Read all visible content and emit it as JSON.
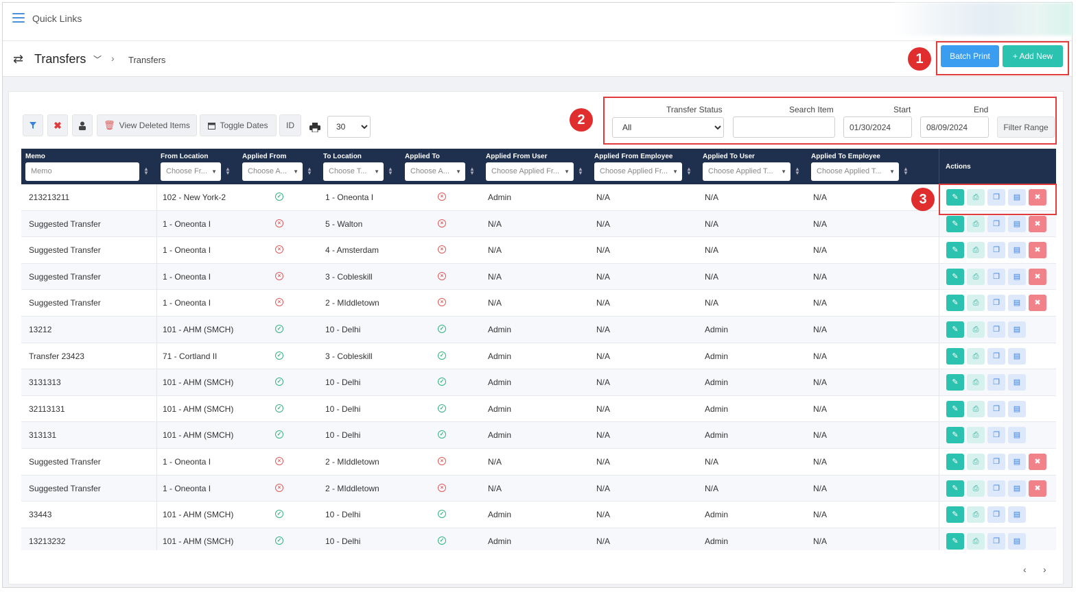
{
  "quick_links": {
    "label": "Quick Links"
  },
  "header": {
    "title": "Transfers",
    "breadcrumb": "Transfers"
  },
  "actions": {
    "batch_print": "Batch Print",
    "add_new": "+ Add New"
  },
  "markers": [
    "1",
    "2",
    "3"
  ],
  "toolbar": {
    "view_deleted": "View Deleted Items",
    "toggle_dates": "Toggle Dates",
    "id": "ID",
    "page_size": "30"
  },
  "filters": {
    "transfer_status_label": "Transfer Status",
    "transfer_status_value": "All",
    "search_item_label": "Search Item",
    "search_item_value": "",
    "start_label": "Start",
    "start_value": "01/30/2024",
    "end_label": "End",
    "end_value": "08/09/2024",
    "filter_range": "Filter Range"
  },
  "columns": {
    "memo": {
      "label": "Memo",
      "placeholder": "Memo"
    },
    "from_location": {
      "label": "From Location",
      "placeholder": "Choose Fr..."
    },
    "applied_from": {
      "label": "Applied From",
      "placeholder": "Choose A..."
    },
    "to_location": {
      "label": "To Location",
      "placeholder": "Choose T..."
    },
    "applied_to": {
      "label": "Applied To",
      "placeholder": "Choose A..."
    },
    "applied_from_user": {
      "label": "Applied From User",
      "placeholder": "Choose Applied Fr..."
    },
    "applied_from_employee": {
      "label": "Applied From Employee",
      "placeholder": "Choose Applied Fr..."
    },
    "applied_to_user": {
      "label": "Applied To User",
      "placeholder": "Choose Applied T..."
    },
    "applied_to_employee": {
      "label": "Applied To Employee",
      "placeholder": "Choose Applied T..."
    },
    "actions": {
      "label": "Actions"
    }
  },
  "rows": [
    {
      "memo": "213213211",
      "from": "102 - New York-2",
      "applied_from": "ok",
      "to": "1 - Oneonta I",
      "applied_to": "bad",
      "from_user": "Admin",
      "from_emp": "N/A",
      "to_user": "N/A",
      "to_emp": "N/A",
      "deletable": true
    },
    {
      "memo": "Suggested Transfer",
      "from": "1 - Oneonta I",
      "applied_from": "bad",
      "to": "5 - Walton",
      "applied_to": "bad",
      "from_user": "N/A",
      "from_emp": "N/A",
      "to_user": "N/A",
      "to_emp": "N/A",
      "deletable": true
    },
    {
      "memo": "Suggested Transfer",
      "from": "1 - Oneonta I",
      "applied_from": "bad",
      "to": "4 - Amsterdam",
      "applied_to": "bad",
      "from_user": "N/A",
      "from_emp": "N/A",
      "to_user": "N/A",
      "to_emp": "N/A",
      "deletable": true
    },
    {
      "memo": "Suggested Transfer",
      "from": "1 - Oneonta I",
      "applied_from": "bad",
      "to": "3 - Cobleskill",
      "applied_to": "bad",
      "from_user": "N/A",
      "from_emp": "N/A",
      "to_user": "N/A",
      "to_emp": "N/A",
      "deletable": true
    },
    {
      "memo": "Suggested Transfer",
      "from": "1 - Oneonta I",
      "applied_from": "bad",
      "to": "2 - MIddletown",
      "applied_to": "bad",
      "from_user": "N/A",
      "from_emp": "N/A",
      "to_user": "N/A",
      "to_emp": "N/A",
      "deletable": true
    },
    {
      "memo": "13212",
      "from": "101 - AHM (SMCH)",
      "applied_from": "ok",
      "to": "10 - Delhi",
      "applied_to": "ok",
      "from_user": "Admin",
      "from_emp": "N/A",
      "to_user": "Admin",
      "to_emp": "N/A",
      "deletable": false
    },
    {
      "memo": "Transfer 23423",
      "from": "71 - Cortland II",
      "applied_from": "ok",
      "to": "3 - Cobleskill",
      "applied_to": "ok",
      "from_user": "Admin",
      "from_emp": "N/A",
      "to_user": "Admin",
      "to_emp": "N/A",
      "deletable": false
    },
    {
      "memo": "3131313",
      "from": "101 - AHM (SMCH)",
      "applied_from": "ok",
      "to": "10 - Delhi",
      "applied_to": "ok",
      "from_user": "Admin",
      "from_emp": "N/A",
      "to_user": "Admin",
      "to_emp": "N/A",
      "deletable": false
    },
    {
      "memo": "32113131",
      "from": "101 - AHM (SMCH)",
      "applied_from": "ok",
      "to": "10 - Delhi",
      "applied_to": "ok",
      "from_user": "Admin",
      "from_emp": "N/A",
      "to_user": "Admin",
      "to_emp": "N/A",
      "deletable": false
    },
    {
      "memo": "313131",
      "from": "101 - AHM (SMCH)",
      "applied_from": "ok",
      "to": "10 - Delhi",
      "applied_to": "ok",
      "from_user": "Admin",
      "from_emp": "N/A",
      "to_user": "Admin",
      "to_emp": "N/A",
      "deletable": false
    },
    {
      "memo": "Suggested Transfer",
      "from": "1 - Oneonta I",
      "applied_from": "bad",
      "to": "2 - MIddletown",
      "applied_to": "bad",
      "from_user": "N/A",
      "from_emp": "N/A",
      "to_user": "N/A",
      "to_emp": "N/A",
      "deletable": true
    },
    {
      "memo": "Suggested Transfer",
      "from": "1 - Oneonta I",
      "applied_from": "bad",
      "to": "2 - MIddletown",
      "applied_to": "bad",
      "from_user": "N/A",
      "from_emp": "N/A",
      "to_user": "N/A",
      "to_emp": "N/A",
      "deletable": true
    },
    {
      "memo": "33443",
      "from": "101 - AHM (SMCH)",
      "applied_from": "ok",
      "to": "10 - Delhi",
      "applied_to": "ok",
      "from_user": "Admin",
      "from_emp": "N/A",
      "to_user": "Admin",
      "to_emp": "N/A",
      "deletable": false
    },
    {
      "memo": "13213232",
      "from": "101 - AHM (SMCH)",
      "applied_from": "ok",
      "to": "10 - Delhi",
      "applied_to": "ok",
      "from_user": "Admin",
      "from_emp": "N/A",
      "to_user": "Admin",
      "to_emp": "N/A",
      "deletable": false
    }
  ],
  "pager": {
    "prev": "‹",
    "next": "›"
  },
  "icons": {
    "menu": "hamburger-icon",
    "transfer": "swap-arrows-icon",
    "filter": "funnel-icon",
    "clear": "x-icon",
    "user": "person-icon",
    "trash": "trash-icon",
    "calendar": "calendar-icon",
    "print": "printer-icon",
    "edit": "pencil-icon",
    "copy": "copy-icon",
    "doc": "document-icon",
    "delete": "close-icon",
    "check": "check-circle-icon",
    "cross": "x-circle-icon"
  },
  "colors": {
    "header_bg": "#1f2f4e",
    "primary_blue": "#3a9df0",
    "teal": "#2bc3b0",
    "danger": "#f2828a",
    "highlight_red": "#e23b3b",
    "status_ok": "#36b37e",
    "status_bad": "#e05a5a"
  }
}
